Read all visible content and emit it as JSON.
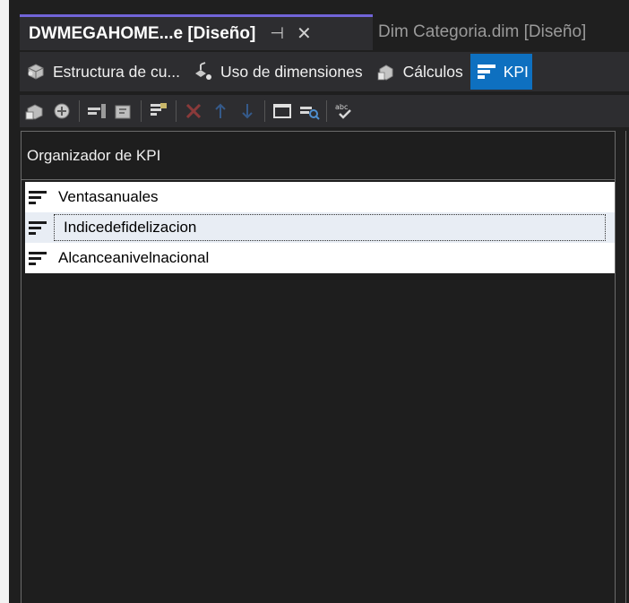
{
  "tabs": {
    "active": {
      "title": "DWMEGAHOME...e [Diseño]",
      "pin_glyph": "⊣",
      "close_glyph": "✕"
    },
    "inactive": {
      "title": "Dim Categoria.dim [Diseño]"
    }
  },
  "designer_tabs": [
    {
      "label": "Estructura de cu...",
      "icon": "cube-structure-icon"
    },
    {
      "label": "Uso de dimensiones",
      "icon": "dimension-usage-icon"
    },
    {
      "label": "Cálculos",
      "icon": "calculations-icon"
    },
    {
      "label": "KPI",
      "icon": "kpi-icon",
      "active": true
    }
  ],
  "toolbar": {
    "buttons": [
      "process-icon",
      "browse-icon",
      "new-kpi-icon",
      "new-calc-icon",
      "form-view-icon",
      "delete-icon",
      "move-up-icon",
      "move-down-icon",
      "window-icon",
      "browser-view-icon",
      "spellcheck-icon"
    ]
  },
  "organizer": {
    "title": "Organizador de KPI",
    "items": [
      {
        "label": "Ventasanuales",
        "selected": false
      },
      {
        "label": "Indicedefidelizacion",
        "selected": true
      },
      {
        "label": "Alcanceanivelnacional",
        "selected": false
      }
    ]
  },
  "colors": {
    "accent_tab_border": "#7164d8",
    "active_designer_tab": "#0e70c0",
    "background": "#1f1f1f"
  }
}
